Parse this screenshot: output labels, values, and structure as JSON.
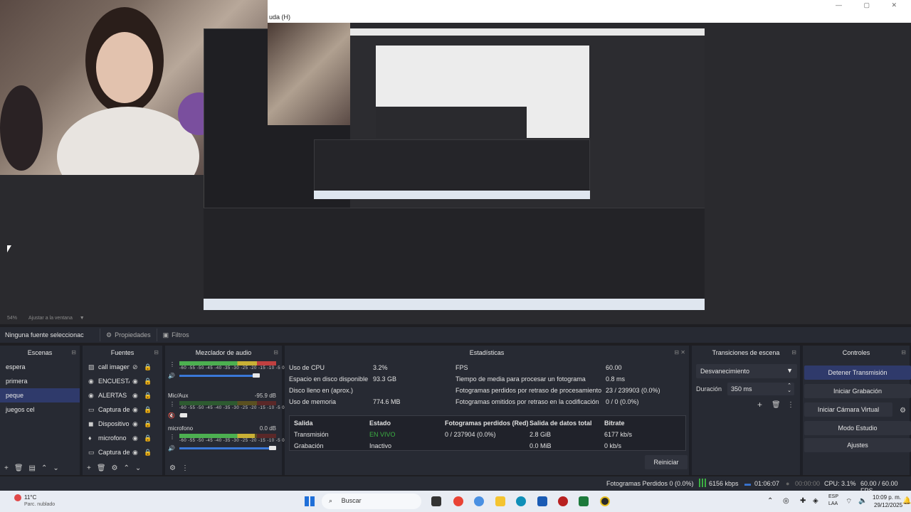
{
  "menubar": {
    "help_label": "uda (H)"
  },
  "preview": {
    "zoom_label": "54%",
    "fit_label": "Ajustar a la ventana"
  },
  "source_toolbar": {
    "no_source_label": "Ninguna fuente seleccionac",
    "properties_label": "Propiedades",
    "filters_label": "Filtros"
  },
  "scenes": {
    "title": "Escenas",
    "items": [
      {
        "label": "espera",
        "selected": false
      },
      {
        "label": "primera",
        "selected": false
      },
      {
        "label": "peque",
        "selected": true
      },
      {
        "label": "juegos cel",
        "selected": false
      }
    ]
  },
  "sources": {
    "title": "Fuentes",
    "items": [
      {
        "label": "call imagen",
        "icon": "image-icon",
        "hidden": true
      },
      {
        "label": "ENCUESTA",
        "icon": "globe-icon",
        "hidden": false
      },
      {
        "label": "ALERTAS",
        "icon": "globe-icon",
        "hidden": false
      },
      {
        "label": "Captura de",
        "icon": "monitor-icon",
        "hidden": false
      },
      {
        "label": "Dispositivo",
        "icon": "camera-icon",
        "hidden": false
      },
      {
        "label": "microfono",
        "icon": "microphone-icon",
        "hidden": false
      },
      {
        "label": "Captura de",
        "icon": "monitor-icon",
        "hidden": false
      }
    ]
  },
  "mixer": {
    "title": "Mezclador de audio",
    "scale": "-60 -55 -50 -45 -40 -35 -30 -25 -20 -15 -10 -5 0",
    "channels": [
      {
        "name": "",
        "db": "",
        "level": 1.0,
        "fader": 0.8,
        "muted": false
      },
      {
        "name": "Mic/Aux",
        "db": "-95.9 dB",
        "level": 0.0,
        "fader": 0.05,
        "muted": true
      },
      {
        "name": "microfono",
        "db": "0.0 dB",
        "level": 0.78,
        "fader": 0.97,
        "muted": false
      }
    ]
  },
  "stats": {
    "title": "Estadísticas",
    "left": [
      {
        "label": "Uso de CPU",
        "value": "3.2%"
      },
      {
        "label": "Espacio en disco disponible",
        "value": "93.3 GB"
      },
      {
        "label": "Disco lleno en (aprox.)",
        "value": ""
      },
      {
        "label": "Uso de memoria",
        "value": "774.6 MB"
      }
    ],
    "right": [
      {
        "label": "FPS",
        "value": "60.00"
      },
      {
        "label": "Tiempo de media para procesar un fotograma",
        "value": "0.8 ms"
      },
      {
        "label": "Fotogramas perdidos por retraso de procesamiento",
        "value": "23 / 239903 (0.0%)"
      },
      {
        "label": "Fotogramas omitidos por retraso en la codificación",
        "value": "0 / 0 (0.0%)"
      }
    ],
    "table_headers": [
      "Salida",
      "Estado",
      "Fotogramas perdidos (Red)",
      "Salida de datos total",
      "Bitrate"
    ],
    "table_rows": [
      [
        "Transmisión",
        "EN VIVO",
        "0 / 237904 (0.0%)",
        "2.8 GiB",
        "6177 kb/s"
      ],
      [
        "Grabación",
        "Inactivo",
        "",
        "0.0 MiB",
        "0 kb/s"
      ]
    ],
    "live_color": "#3cb043",
    "reset_label": "Reiniciar"
  },
  "transitions": {
    "title": "Transiciones de escena",
    "selected": "Desvanecimiento",
    "duration_label": "Duración",
    "duration_value": "350 ms"
  },
  "controls": {
    "title": "Controles",
    "buttons": [
      {
        "label": "Detener Transmisión",
        "active": true
      },
      {
        "label": "Iniciar Grabación",
        "active": false
      },
      {
        "label": "Iniciar Cámara Virtual",
        "active": false
      },
      {
        "label": "Modo Estudio",
        "active": false
      },
      {
        "label": "Ajustes",
        "active": false
      }
    ]
  },
  "status": {
    "dropped": "Fotogramas Perdidos 0 (0.0%)",
    "kbps": "6156 kbps",
    "live_time": "01:06:07",
    "rec_time": "00:00:00",
    "cpu": "CPU: 3.1%",
    "fps": "60.00 / 60.00 FPS"
  },
  "taskbar": {
    "weather_temp": "11°C",
    "weather_desc": "Parc. nublado",
    "search_placeholder": "Buscar",
    "lang": "ESP",
    "lang_sub": "LAA",
    "time": "10:09 p. m.",
    "date": "29/12/2025"
  }
}
